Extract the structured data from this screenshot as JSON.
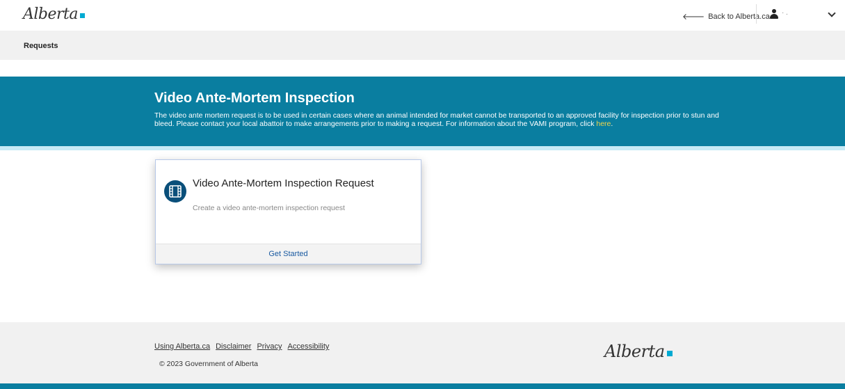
{
  "header": {
    "logo_text": "Alberta",
    "back_link": "Back to Alberta.ca",
    "user_name": "·  ."
  },
  "subnav": {
    "title": "Requests"
  },
  "banner": {
    "title": "Video Ante-Mortem Inspection",
    "description": "The video ante mortem request is to be used in certain cases where an animal intended for market cannot be transported to an approved facility for inspection prior to stun and bleed. Please contact your local abattoir to make arrangements prior to making a request. For information about the VAMI program, click ",
    "link_text": "here",
    "description_end": "."
  },
  "card": {
    "icon": "film-icon",
    "title": "Video Ante-Mortem Inspection Request",
    "subtitle": "Create a video ante-mortem inspection request",
    "action": "Get Started"
  },
  "footer": {
    "links": [
      "Using Alberta.ca",
      "Disclaimer",
      "Privacy",
      "Accessibility"
    ],
    "copyright": "© 2023 Government of Alberta",
    "logo_text": "Alberta"
  },
  "colors": {
    "brand_teal": "#0a7ea0",
    "accent_square": "#00aad2",
    "link_blue": "#1a5aa0",
    "link_yellow": "#f0d44a"
  }
}
